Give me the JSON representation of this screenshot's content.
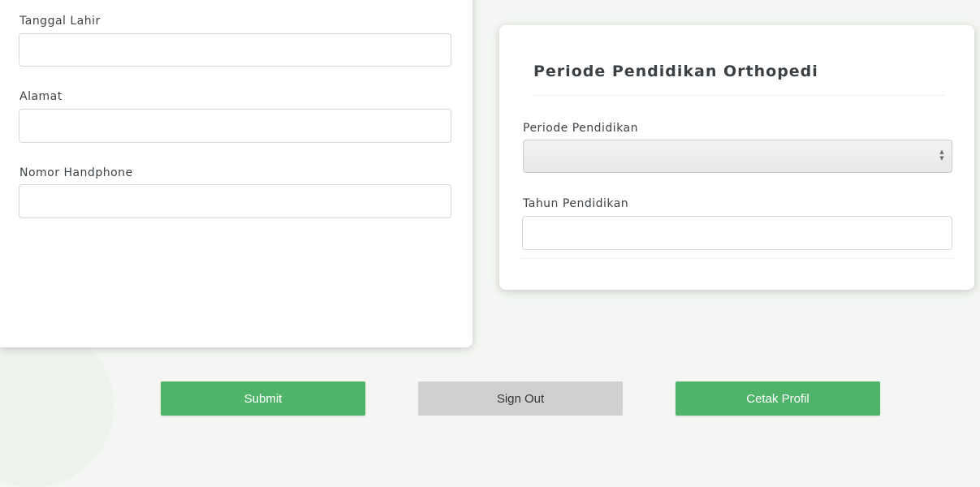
{
  "left_card": {
    "fields": [
      {
        "label": "Tanggal Lahir",
        "value": ""
      },
      {
        "label": "Alamat",
        "value": ""
      },
      {
        "label": "Nomor Handphone",
        "value": ""
      }
    ]
  },
  "right_card": {
    "title": "Periode Pendidikan Orthopedi",
    "periode": {
      "label": "Periode Pendidikan",
      "selected": ""
    },
    "tahun": {
      "label": "Tahun Pendidikan",
      "value": ""
    }
  },
  "actions": {
    "submit": "Submit",
    "sign_out": "Sign Out",
    "cetak_profil": "Cetak Profil"
  },
  "colors": {
    "primary_button": "#4fb46a",
    "secondary_button": "#cfd0d0",
    "page_background": "#f3f6f2"
  }
}
